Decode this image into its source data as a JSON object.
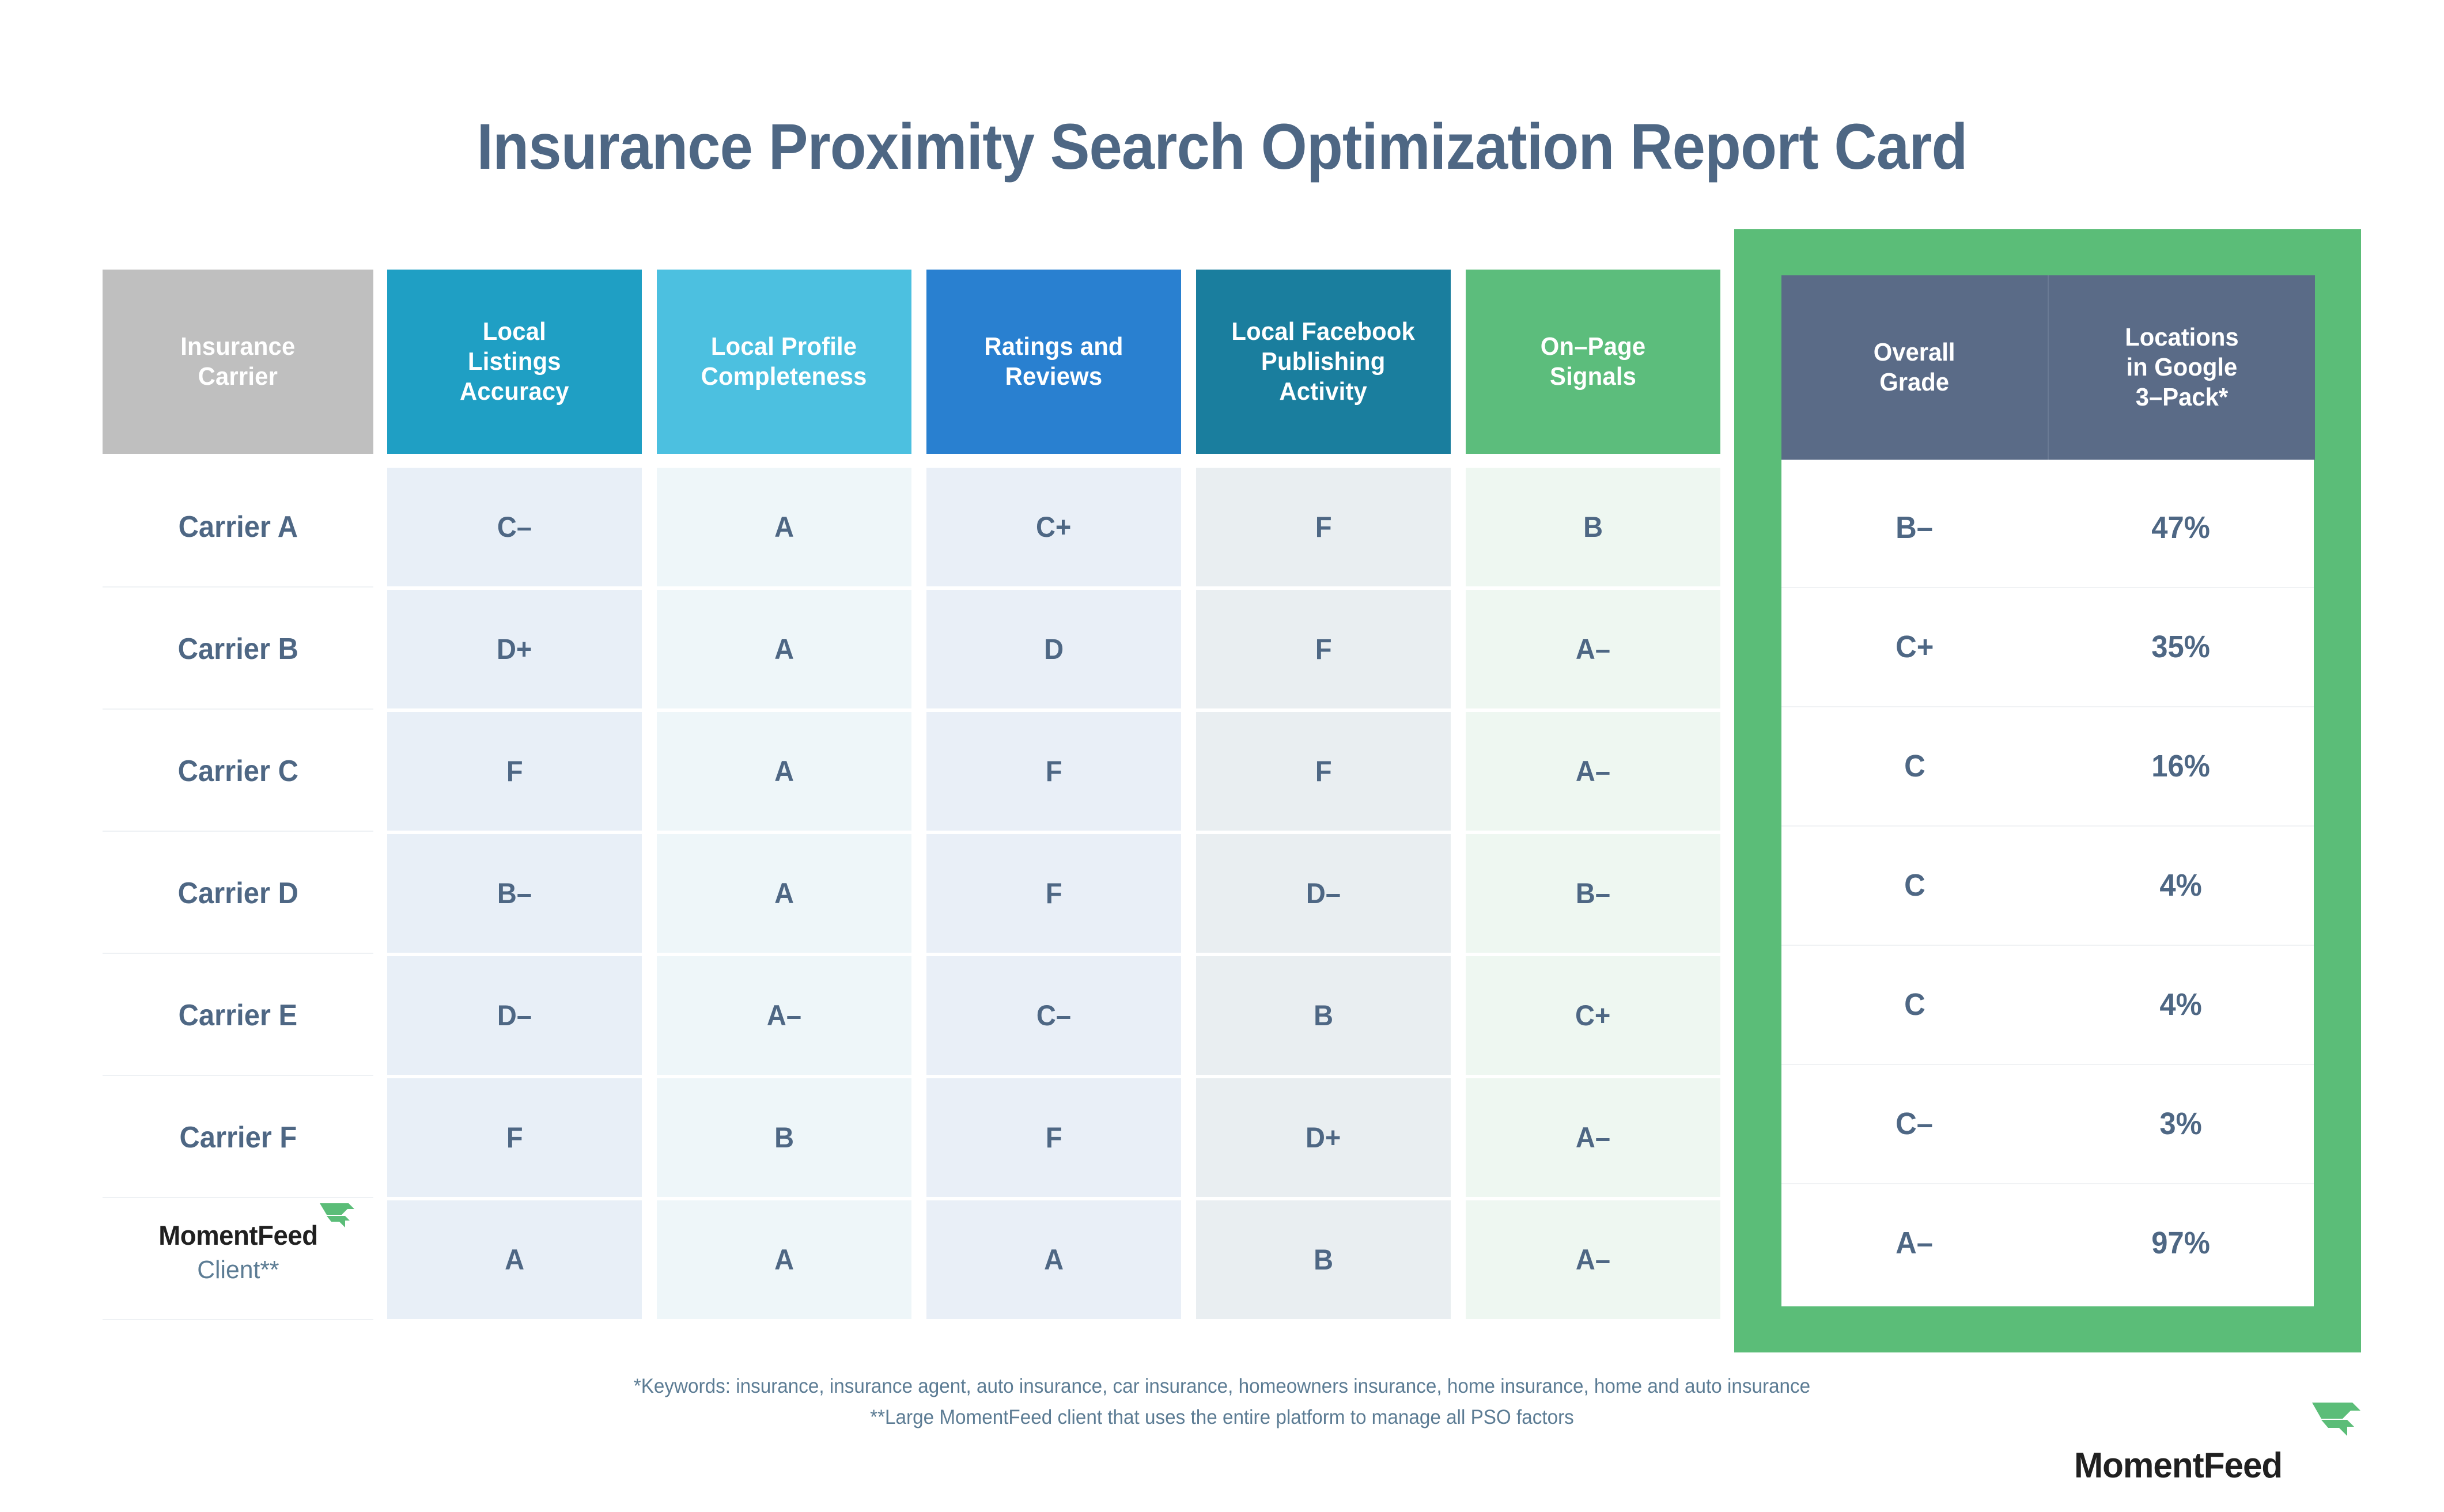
{
  "title": "Insurance Proximity Search Optimization Report Card",
  "colors": {
    "title_text": "#4e6784",
    "value_text": "#4e6784",
    "carrier_header_bg": "#bfbfbf",
    "local_listings_bg": "#1f9fc4",
    "local_profile_bg": "#4cc0e0",
    "ratings_bg": "#2980d0",
    "facebook_bg": "#1a7e9e",
    "onpage_bg": "#5cbd7c",
    "highlight_border": "#5bbd78",
    "highlight_header_bg": "#5a6b87",
    "brand_green": "#5bbd78"
  },
  "table": {
    "columns": [
      {
        "key": "carrier",
        "label": "Insurance\nCarrier",
        "lines": [
          "Insurance",
          "Carrier"
        ],
        "header_bg": "#bfbfbf",
        "cell_bg": "#ffffff"
      },
      {
        "key": "listings",
        "label": "Local Listings Accuracy",
        "lines": [
          "Local",
          "Listings",
          "Accuracy"
        ],
        "header_bg": "#1f9fc4",
        "cell_bg": "#e8eff7"
      },
      {
        "key": "profile",
        "label": "Local Profile Completeness",
        "lines": [
          "Local Profile",
          "Completeness"
        ],
        "header_bg": "#4cc0e0",
        "cell_bg": "#eef6f9"
      },
      {
        "key": "ratings",
        "label": "Ratings and Reviews",
        "lines": [
          "Ratings and",
          "Reviews"
        ],
        "header_bg": "#2980d0",
        "cell_bg": "#e9eff7"
      },
      {
        "key": "facebook",
        "label": "Local Facebook Publishing Activity",
        "lines": [
          "Local Facebook",
          "Publishing",
          "Activity"
        ],
        "header_bg": "#1a7e9e",
        "cell_bg": "#e9eef1"
      },
      {
        "key": "onpage",
        "label": "On-Page Signals",
        "lines": [
          "On–Page",
          "Signals"
        ],
        "header_bg": "#5cbd7c",
        "cell_bg": "#eef7f1"
      }
    ],
    "highlight_columns": [
      {
        "key": "overall",
        "label": "Overall Grade",
        "lines": [
          "Overall",
          "Grade"
        ]
      },
      {
        "key": "locations",
        "label": "Locations in Google 3-Pack*",
        "lines": [
          "Locations",
          "in Google",
          "3–Pack*"
        ]
      }
    ],
    "rows": [
      {
        "carrier": "Carrier A",
        "listings": "C–",
        "profile": "A",
        "ratings": "C+",
        "facebook": "F",
        "onpage": "B",
        "overall": "B–",
        "locations": "47%"
      },
      {
        "carrier": "Carrier B",
        "listings": "D+",
        "profile": "A",
        "ratings": "D",
        "facebook": "F",
        "onpage": "A–",
        "overall": "C+",
        "locations": "35%"
      },
      {
        "carrier": "Carrier C",
        "listings": "F",
        "profile": "A",
        "ratings": "F",
        "facebook": "F",
        "onpage": "A–",
        "overall": "C",
        "locations": "16%"
      },
      {
        "carrier": "Carrier D",
        "listings": "B–",
        "profile": "A",
        "ratings": "F",
        "facebook": "D–",
        "onpage": "B–",
        "overall": "C",
        "locations": "4%"
      },
      {
        "carrier": "Carrier E",
        "listings": "D–",
        "profile": "A–",
        "ratings": "C–",
        "facebook": "B",
        "onpage": "C+",
        "overall": "C",
        "locations": "4%"
      },
      {
        "carrier": "Carrier F",
        "listings": "F",
        "profile": "B",
        "ratings": "F",
        "facebook": "D+",
        "onpage": "A–",
        "overall": "C–",
        "locations": "3%"
      },
      {
        "carrier": "",
        "listings": "A",
        "profile": "A",
        "ratings": "A",
        "facebook": "B",
        "onpage": "A–",
        "overall": "A–",
        "locations": "97%"
      }
    ]
  },
  "client_row": {
    "wordmark": "MomentFeed",
    "sublabel": "Client**"
  },
  "footnotes": {
    "line1": "*Keywords: insurance, insurance agent, auto insurance, car insurance, homeowners insurance, home insurance, home and auto insurance",
    "line2": "**Large MomentFeed client that uses the entire platform to manage all PSO factors"
  },
  "brand_logo": {
    "wordmark": "MomentFeed"
  }
}
